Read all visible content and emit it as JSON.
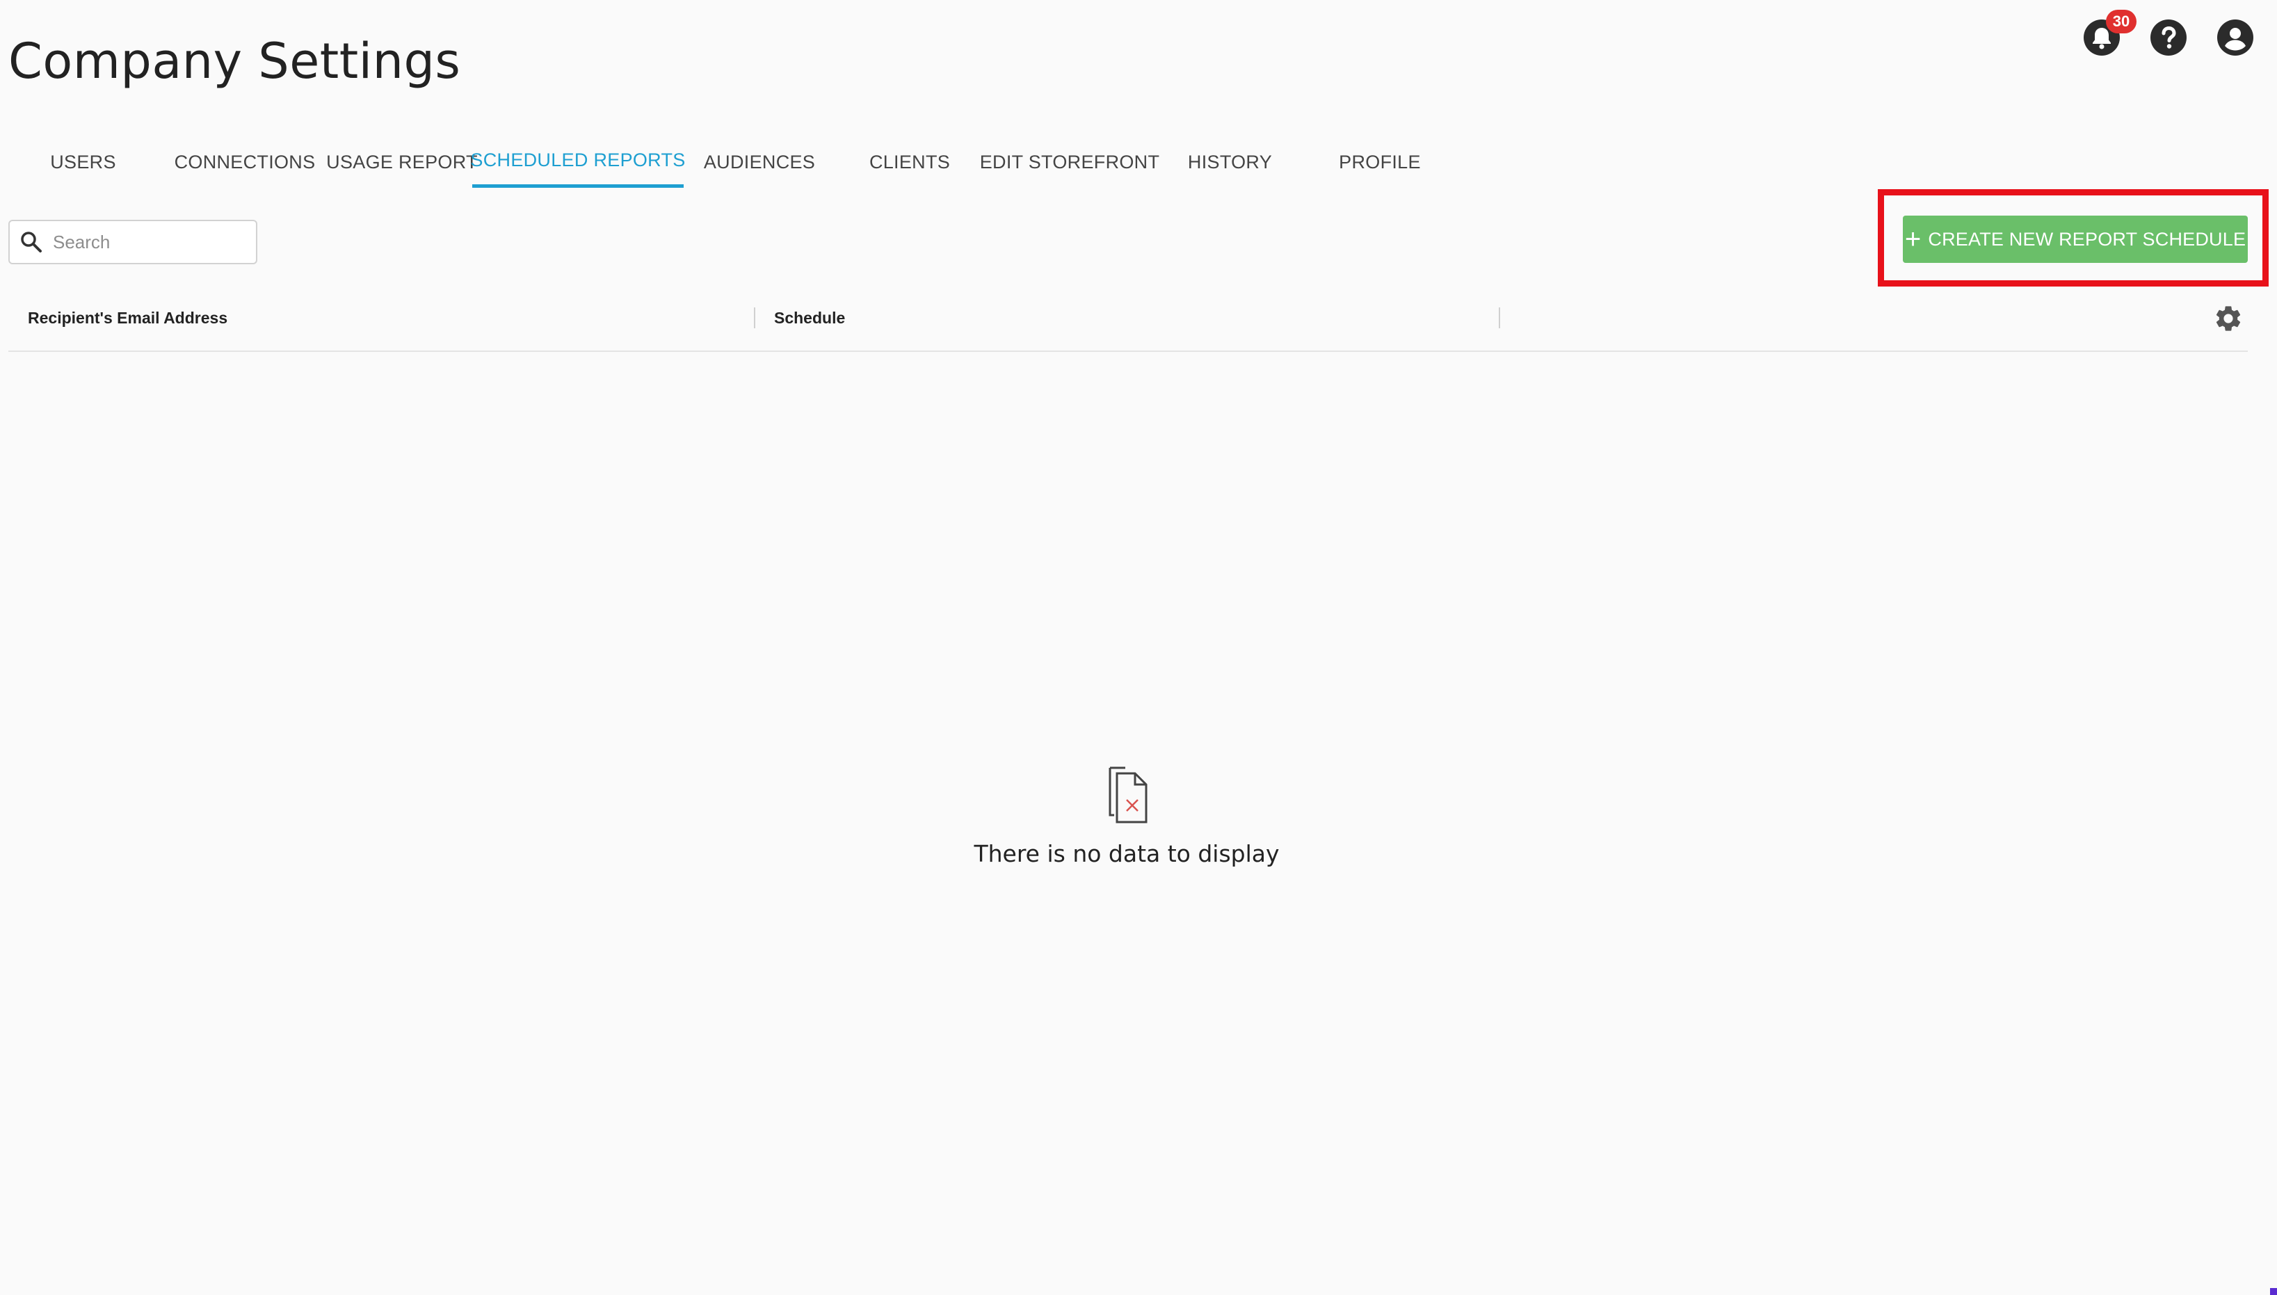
{
  "page": {
    "title": "Company Settings"
  },
  "header": {
    "notifications": {
      "icon": "bell-icon",
      "badge_count": "30"
    },
    "help": {
      "icon": "help-circle-icon"
    },
    "account": {
      "icon": "account-circle-icon"
    }
  },
  "tabs": [
    {
      "label": "USERS",
      "active": false
    },
    {
      "label": "CONNECTIONS",
      "active": false
    },
    {
      "label": "USAGE REPORT",
      "active": false
    },
    {
      "label": "SCHEDULED REPORTS",
      "active": true
    },
    {
      "label": "AUDIENCES",
      "active": false
    },
    {
      "label": "CLIENTS",
      "active": false
    },
    {
      "label": "EDIT STOREFRONT",
      "active": false
    },
    {
      "label": "HISTORY",
      "active": false
    },
    {
      "label": "PROFILE",
      "active": false
    }
  ],
  "search": {
    "placeholder": "Search",
    "value": "",
    "icon": "search-icon"
  },
  "actions": {
    "create_label": "CREATE NEW REPORT SCHEDULE",
    "create_icon": "plus-icon"
  },
  "table": {
    "columns": [
      "Recipient's Email Address",
      "Schedule"
    ],
    "settings_icon": "gear-icon",
    "rows": []
  },
  "empty_state": {
    "icon": "no-data-document-icon",
    "message": "There is no data to display"
  },
  "colors": {
    "accent": "#1e9fd1",
    "primary_button": "#6abf69",
    "badge": "#e0302f",
    "highlight": "#e8111a"
  }
}
